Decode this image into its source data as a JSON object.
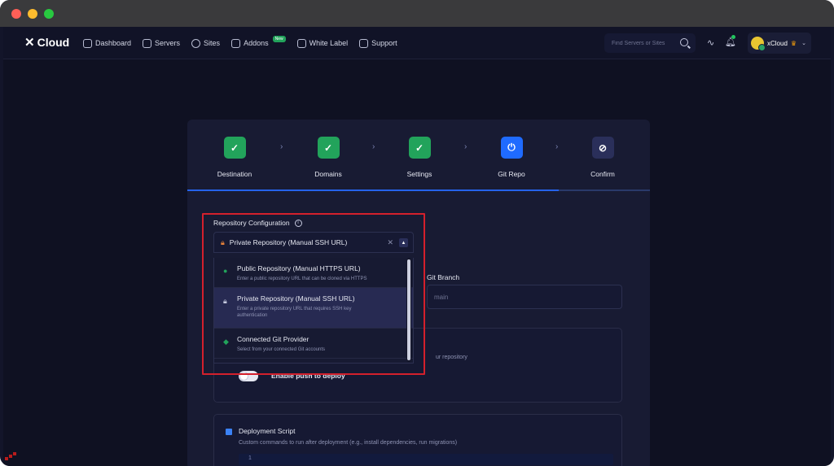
{
  "nav": {
    "logo": "Cloud",
    "items": [
      {
        "label": "Dashboard",
        "icon": "dashboard-icon"
      },
      {
        "label": "Servers",
        "icon": "servers-icon"
      },
      {
        "label": "Sites",
        "icon": "globe-icon"
      },
      {
        "label": "Addons",
        "icon": "puzzle-icon",
        "badge": "New"
      },
      {
        "label": "White Label",
        "icon": "white-label-icon"
      },
      {
        "label": "Support",
        "icon": "support-icon"
      }
    ],
    "search_placeholder": "Find Servers or Sites",
    "user_name": "xCloud"
  },
  "stepper": {
    "steps": [
      {
        "label": "Destination",
        "state": "done"
      },
      {
        "label": "Domains",
        "state": "done"
      },
      {
        "label": "Settings",
        "state": "done"
      },
      {
        "label": "Git Repo",
        "state": "active"
      },
      {
        "label": "Confirm",
        "state": "todo"
      }
    ]
  },
  "repo_config": {
    "label": "Repository Configuration",
    "selected": "Private Repository (Manual SSH URL)",
    "options": [
      {
        "title": "Public Repository (Manual HTTPS URL)",
        "desc": "Enter a public repository URL that can be cloned via HTTPS"
      },
      {
        "title": "Private Repository (Manual SSH URL)",
        "desc": "Enter a private repository URL that requires SSH key authentication"
      },
      {
        "title": "Connected Git Provider",
        "desc": "Select from your connected Git accounts"
      }
    ]
  },
  "git_branch": {
    "label": "Git Branch",
    "placeholder": "main"
  },
  "repo_tail": "ur repository",
  "push_toggle_label": "Enable push to deploy",
  "deployment": {
    "title": "Deployment Script",
    "desc": "Custom commands to run after deployment (e.g., install dependencies, run migrations)",
    "line_number": "1"
  },
  "colors": {
    "accent": "#1f6bff",
    "success": "#22a35b",
    "highlight": "#d4202c"
  }
}
